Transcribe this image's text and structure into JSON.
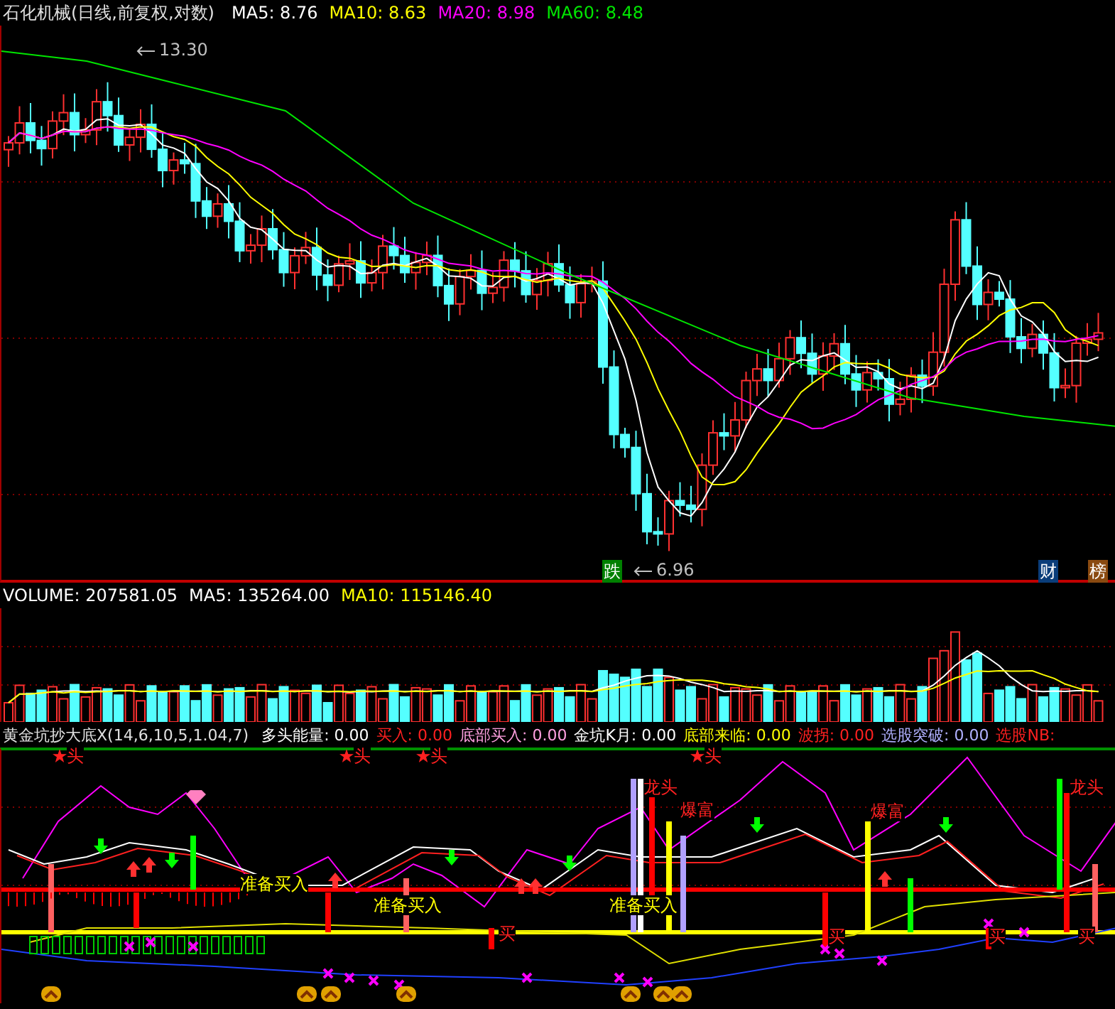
{
  "price_panel": {
    "title": "石化机械(日线,前复权,对数)",
    "indicators": [
      {
        "label": "MA5: 8.76",
        "color": "#ffffff"
      },
      {
        "label": "MA10: 8.63",
        "color": "#ffff00"
      },
      {
        "label": "MA20: 8.98",
        "color": "#ff00ff"
      },
      {
        "label": "MA60: 8.48",
        "color": "#00e600"
      }
    ],
    "annotations": [
      {
        "text": "13.30"
      },
      {
        "text": "6.96"
      }
    ],
    "badges": [
      {
        "text": "跌",
        "color": "#008000"
      },
      {
        "text": "财",
        "color": "#0a3d7a"
      },
      {
        "text": "榜",
        "color": "#8a4a10"
      }
    ]
  },
  "volume_panel": {
    "indicators": [
      {
        "label": "VOLUME: 207581.05",
        "color": "#ffffff"
      },
      {
        "label": "MA5: 135264.00",
        "color": "#ffffff"
      },
      {
        "label": "MA10: 115146.40",
        "color": "#ffff00"
      }
    ]
  },
  "indicator_panel": {
    "title": "黄金坑抄大底X(14,6,10,5,1.04,7)",
    "indicators": [
      {
        "label": "多头能量: 0.00",
        "color": "#ffffff"
      },
      {
        "label": "买入: 0.00",
        "color": "#ff2020"
      },
      {
        "label": "底部买入: 0.00",
        "color": "#ffa0e0"
      },
      {
        "label": "金坑K月: 0.00",
        "color": "#ffffff"
      },
      {
        "label": "底部来临: 0.00",
        "color": "#ffff00"
      },
      {
        "label": "波拐: 0.00",
        "color": "#ff2020"
      },
      {
        "label": "选股突破: 0.00",
        "color": "#b0b0ff"
      },
      {
        "label": "选股NB:",
        "color": "#ff2020"
      }
    ],
    "signals": [
      {
        "kind": "star",
        "text": "头"
      },
      {
        "kind": "star",
        "text": "头"
      },
      {
        "kind": "star",
        "text": "头"
      },
      {
        "kind": "star",
        "text": "头"
      },
      {
        "kind": "label",
        "text": "龙头"
      },
      {
        "kind": "label",
        "text": "爆富"
      },
      {
        "kind": "label",
        "text": "爆富"
      },
      {
        "kind": "label",
        "text": "龙头"
      },
      {
        "kind": "buy",
        "text": "准备买入"
      },
      {
        "kind": "buy",
        "text": "准备买入"
      },
      {
        "kind": "buy",
        "text": "准备买入"
      },
      {
        "kind": "label",
        "text": "买"
      },
      {
        "kind": "label",
        "text": "买"
      },
      {
        "kind": "label",
        "text": "买"
      },
      {
        "kind": "label",
        "text": "买"
      }
    ]
  }
}
